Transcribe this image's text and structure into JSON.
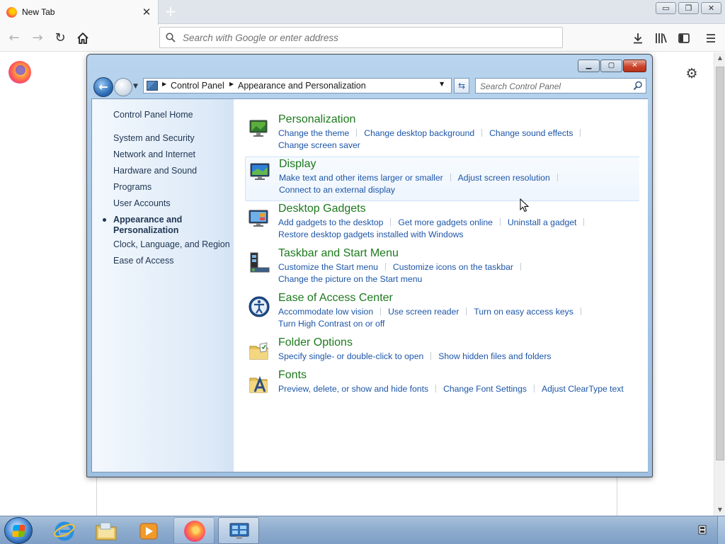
{
  "browser": {
    "tab": {
      "title": "New Tab",
      "close": "✕",
      "favicon": "firefox-icon"
    },
    "new_tab": "+",
    "window_controls": {
      "minimize": "▭",
      "restore": "❐",
      "close": "✕"
    },
    "toolbar": {
      "back": "←",
      "forward": "→",
      "reload": "↻",
      "home": "⌂",
      "search_placeholder": "Search with Google or enter address",
      "downloads": "⤓",
      "library": "|||\\",
      "sidebar": "▥",
      "menu": "≡"
    },
    "newtab_settings": "⚙"
  },
  "control_panel": {
    "caption": {
      "minimize": "▁",
      "maximize": "▢",
      "close": "✕"
    },
    "nav": {
      "back": "←",
      "history": "▼"
    },
    "breadcrumb": [
      "Control Panel",
      "Appearance and Personalization"
    ],
    "breadcrumb_sep": "▶",
    "address_dropdown": "▼",
    "refresh": "⇆",
    "search_placeholder": "Search Control Panel",
    "sidebar": [
      {
        "label": "Control Panel Home"
      },
      {
        "label": "System and Security"
      },
      {
        "label": "Network and Internet"
      },
      {
        "label": "Hardware and Sound"
      },
      {
        "label": "Programs"
      },
      {
        "label": "User Accounts"
      },
      {
        "label": "Appearance and\nPersonalization",
        "current": true
      },
      {
        "label": "Clock, Language, and Region"
      },
      {
        "label": "Ease of Access"
      }
    ],
    "categories": [
      {
        "title": "Personalization",
        "icon": "personalization-icon",
        "links": [
          "Change the theme",
          "Change desktop background",
          "Change sound effects",
          "Change screen saver"
        ]
      },
      {
        "title": "Display",
        "icon": "display-icon",
        "links": [
          "Make text and other items larger or smaller",
          "Adjust screen resolution",
          "Connect to an external display"
        ]
      },
      {
        "title": "Desktop Gadgets",
        "icon": "desktop-gadgets-icon",
        "links": [
          "Add gadgets to the desktop",
          "Get more gadgets online",
          "Uninstall a gadget",
          "Restore desktop gadgets installed with Windows"
        ]
      },
      {
        "title": "Taskbar and Start Menu",
        "icon": "taskbar-icon",
        "links": [
          "Customize the Start menu",
          "Customize icons on the taskbar",
          "Change the picture on the Start menu"
        ]
      },
      {
        "title": "Ease of Access Center",
        "icon": "ease-of-access-icon",
        "links": [
          "Accommodate low vision",
          "Use screen reader",
          "Turn on easy access keys",
          "Turn High Contrast on or off"
        ]
      },
      {
        "title": "Folder Options",
        "icon": "folder-options-icon",
        "links": [
          "Specify single- or double-click to open",
          "Show hidden files and folders"
        ]
      },
      {
        "title": "Fonts",
        "icon": "fonts-icon",
        "links": [
          "Preview, delete, or show and hide fonts",
          "Change Font Settings",
          "Adjust ClearType text"
        ]
      }
    ]
  },
  "taskbar": {
    "items": [
      {
        "name": "internet-explorer-icon"
      },
      {
        "name": "file-explorer-icon"
      },
      {
        "name": "media-player-icon"
      },
      {
        "name": "firefox-icon",
        "state": "running"
      },
      {
        "name": "control-panel-icon",
        "state": "active"
      }
    ]
  },
  "colors": {
    "category_title": "#1d7a1d",
    "link": "#1d56a8",
    "sidebar_text": "#1f3552"
  }
}
